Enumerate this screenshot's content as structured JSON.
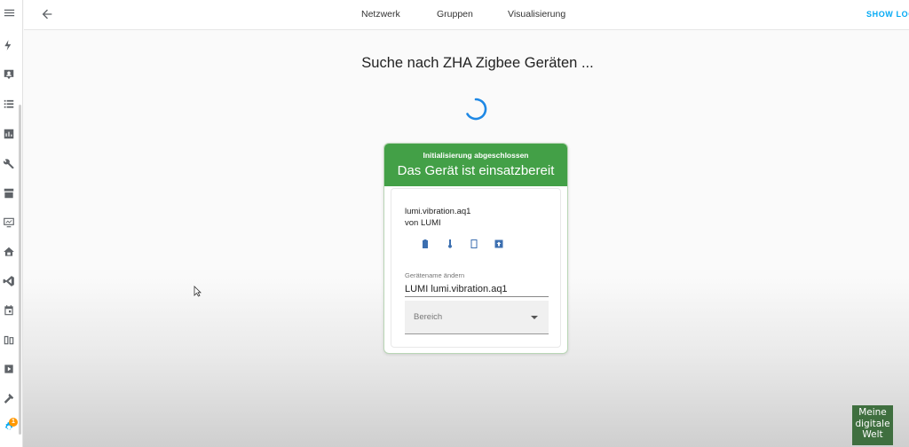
{
  "nav": {
    "tabs": [
      {
        "label": "Netzwerk"
      },
      {
        "label": "Gruppen"
      },
      {
        "label": "Visualisierung"
      }
    ],
    "show_logs": "SHOW LOGS"
  },
  "sidebar": {
    "icons": [
      "menu-icon",
      "lightning-icon",
      "person-card-icon",
      "list-icon",
      "chart-icon",
      "wrench-icon",
      "store-icon",
      "monitor-icon",
      "home-icon",
      "vscode-icon",
      "calendar-icon",
      "battery-icon",
      "media-icon",
      "hammer-icon",
      "settings-icon"
    ],
    "settings_badge": "1"
  },
  "main": {
    "search_title": "Suche nach ZHA Zigbee Geräten ...",
    "card": {
      "subtitle": "Initialisierung abgeschlossen",
      "title": "Das Gerät ist einsatzbereit",
      "model": "lumi.vibration.aq1",
      "vendor": "von LUMI",
      "entity_icons": [
        "battery-icon",
        "thermometer-icon",
        "device-icon",
        "entity-icon"
      ],
      "rename_label": "Gerätename ändern",
      "rename_value": "LUMI lumi.vibration.aq1",
      "area_placeholder": "Bereich"
    }
  },
  "watermark": {
    "line1": "Meine",
    "line2": "digitale",
    "line3": "Welt"
  },
  "colors": {
    "accent": "#03a9f4",
    "success": "#43a047",
    "icon": "#5f6368",
    "entity_icon": "#3c6fb0"
  }
}
